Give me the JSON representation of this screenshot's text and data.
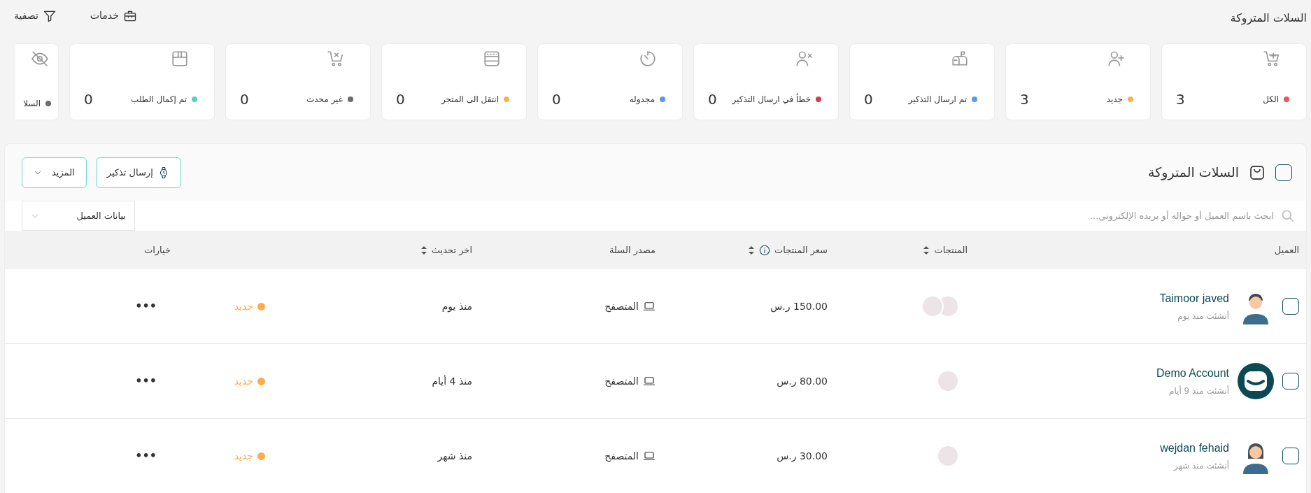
{
  "page_title": "السلات المتروكة",
  "toolbar": [
    {
      "kind": "services",
      "label": "خدمات"
    },
    {
      "kind": "filter",
      "label": "تصفية"
    }
  ],
  "stat_cards": [
    {
      "label": "الكل",
      "count": "3",
      "color": "#f5515a"
    },
    {
      "label": "جديد",
      "count": "3",
      "color": "#ffb14e"
    },
    {
      "label": "تم ارسال التذكير",
      "count": "0",
      "color": "#5a97f5"
    },
    {
      "label": "خطأ في ارسال التذكير",
      "count": "0",
      "color": "#d63d4b"
    },
    {
      "label": "مجدوله",
      "count": "0",
      "color": "#5a97f5"
    },
    {
      "label": "انتقل الى المتجر",
      "count": "0",
      "color": "#f5b04f"
    },
    {
      "label": "غير محدث",
      "count": "0",
      "color": "#6b6b6b"
    },
    {
      "label": "تم إكمال الطلب",
      "count": "0",
      "color": "#5bcfb9"
    },
    {
      "label": "السلا",
      "color": "#6b6b6b"
    }
  ],
  "panel": {
    "title": "السلات المتروكة",
    "select_all_checked": false,
    "buttons": [
      {
        "kind": "reminder",
        "label": "إرسال تذكير"
      },
      {
        "kind": "more",
        "label": "المزيد"
      }
    ],
    "search": {
      "placeholder": "ابحث باسم العميل أو جواله أو بريده الإلكتروني..."
    },
    "filter_dropdown": {
      "label": "بيانات العميل"
    }
  },
  "table": {
    "columns": [
      {
        "label": "العميل",
        "sortable": false,
        "info": false
      },
      {
        "label": "المنتجات",
        "sortable": true,
        "info": false
      },
      {
        "label": "سعر المنتجات",
        "sortable": true,
        "info": true
      },
      {
        "label": "مصدر السلة",
        "sortable": false,
        "info": false
      },
      {
        "label": "اخر تحديث",
        "sortable": true,
        "info": false
      },
      {
        "label": "خيارات",
        "sortable": false,
        "info": false
      }
    ],
    "rows": [
      {
        "checked": false,
        "name": "Taimoor javed",
        "created": "أنشئت منذ يوم",
        "price": "150.00 ر.س",
        "source": "المتصفح",
        "updated": "منذ يوم",
        "status": {
          "label": "جديد",
          "color": "#ffad4a"
        },
        "options": "•••"
      },
      {
        "checked": false,
        "name": "Demo Account",
        "created": "أنشئت منذ 9 أيام",
        "price": "80.00 ر.س",
        "source": "المتصفح",
        "updated": "منذ 4 أيام",
        "status": {
          "label": "جديد",
          "color": "#ffad4a"
        },
        "options": "•••"
      },
      {
        "checked": false,
        "name": "wejdan fehaid",
        "created": "أنشئت منذ شهر",
        "price": "30.00 ر.س",
        "source": "المتصفح",
        "updated": "منذ شهر",
        "status": {
          "label": "جديد",
          "color": "#ffad4a"
        },
        "options": "•••"
      }
    ]
  }
}
